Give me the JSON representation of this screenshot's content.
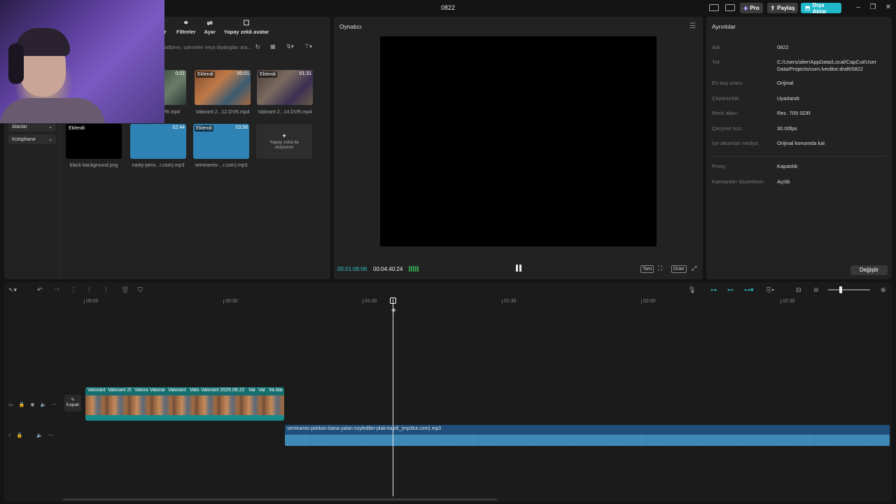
{
  "app": {
    "title": "0822"
  },
  "titlebar": {
    "pro_label": "Pro",
    "share_label": "Paylaş",
    "export_label": "Dışa Aktar"
  },
  "media": {
    "tools": [
      "ar",
      "Filtreler",
      "Ayar",
      "Yapay zekâ avatar"
    ],
    "search_placeholder": "adlarını, sahneleri veya diyalogları ara...",
    "sidebar": [
      "Alanlar",
      "Kütüphane"
    ],
    "items": [
      {
        "name": "DVR.mp4",
        "badge": "",
        "duration": "0:01"
      },
      {
        "name": "Valorant 2...12.DVR.mp4",
        "badge": "Eklendi",
        "duration": "00:01"
      },
      {
        "name": "Valorant 2...14.DVR.mp4",
        "badge": "Eklendi",
        "duration": "01:31"
      },
      {
        "name": "black-background.png",
        "badge": "Eklendi",
        "duration": ""
      },
      {
        "name": "nasty-jams...r.com).mp3",
        "badge": "",
        "duration": "02:44"
      },
      {
        "name": "semiramis-...r.com).mp3",
        "badge": "Eklendi",
        "duration": "03:58"
      }
    ],
    "ai_add": "Yapay zekâ ile oluşturun"
  },
  "player": {
    "title": "Oynatıcı",
    "current_time": "00:01:06:06",
    "total_time": "00:04:40:24",
    "full_label": "Tam",
    "ratio_label": "Oran"
  },
  "details": {
    "title": "Ayrıntılar",
    "rows": [
      {
        "key": "Adı:",
        "value": "0822"
      },
      {
        "key": "Yol:",
        "value": "C:/Users/alier/AppData/Local/CapCut/User Data/Projects/com.lveditor.draft/0822"
      },
      {
        "key": "En boy oranı:",
        "value": "Orijinal"
      },
      {
        "key": "Çözünürlük:",
        "value": "Uyarlandı"
      },
      {
        "key": "Renk alanı:",
        "value": "Rec. 709 SDR"
      },
      {
        "key": "Çerçeve hızı:",
        "value": "30.00fps"
      },
      {
        "key": "İçe aktarılan medya:",
        "value": "Orijinal konumda kal"
      },
      {
        "key": "Proxy:",
        "value": "Kapatıldı"
      },
      {
        "key": "Katmanları düzenleyin",
        "value": "Açıldı"
      }
    ],
    "modify_label": "Değiştir"
  },
  "timeline": {
    "ticks": [
      "00:00",
      "00:30",
      "01:00",
      "01:30",
      "02:00",
      "02:30"
    ],
    "cover_label": "Kapak",
    "video_clip_labels": [
      "Valorant",
      "Valorant 20",
      "Valora",
      "Valorar",
      "Valorant",
      "Valo",
      "Valorant 2025.08.22",
      "Val",
      "Val",
      "Va",
      "bla"
    ],
    "audio_clip_label": "semiramis-pekkan-bana-yalan-soylediler-plak-kaydi_(mp3tur.com).mp3"
  },
  "colors": {
    "accent": "#35c6c6",
    "export": "#1fb8c9",
    "video_track": "#166e6e",
    "audio_track": "#1f4f7a"
  }
}
